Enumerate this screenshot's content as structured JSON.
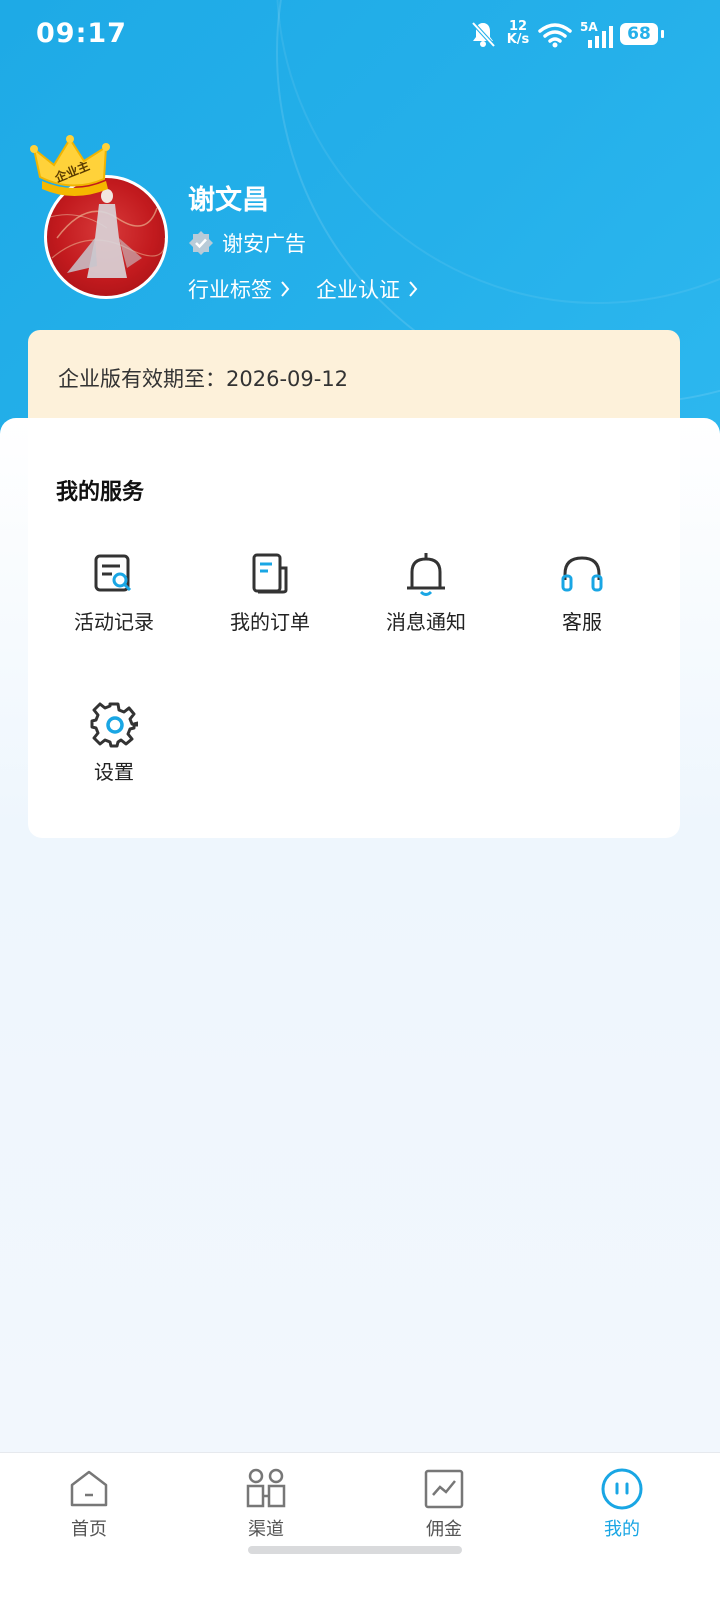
{
  "status_bar": {
    "time": "09:17",
    "net_speed_value": "12",
    "net_speed_unit": "K/s",
    "signal_label": "5A",
    "battery": "68"
  },
  "profile": {
    "badge": "企业主",
    "name": "谢文昌",
    "company": "谢安广告",
    "links": [
      "行业标签",
      "企业认证"
    ]
  },
  "enterprise": {
    "validity_text": "企业版有效期至：2026-09-12"
  },
  "services": {
    "title": "我的服务",
    "items": [
      {
        "label": "活动记录",
        "icon": "activity-record-icon"
      },
      {
        "label": "我的订单",
        "icon": "order-icon"
      },
      {
        "label": "消息通知",
        "icon": "bell-icon"
      },
      {
        "label": "客服",
        "icon": "headset-icon"
      },
      {
        "label": "设置",
        "icon": "gear-icon"
      }
    ]
  },
  "bottom_nav": {
    "items": [
      {
        "label": "首页",
        "icon": "home-icon",
        "active": false
      },
      {
        "label": "渠道",
        "icon": "channel-icon",
        "active": false
      },
      {
        "label": "佣金",
        "icon": "commission-chart-icon",
        "active": false
      },
      {
        "label": "我的",
        "icon": "profile-icon",
        "active": true
      }
    ]
  },
  "colors": {
    "header": "#25b0ea",
    "accent": "#19a6e4",
    "card_cream": "#fdf1da",
    "page_bg": "#f2f7fd"
  }
}
